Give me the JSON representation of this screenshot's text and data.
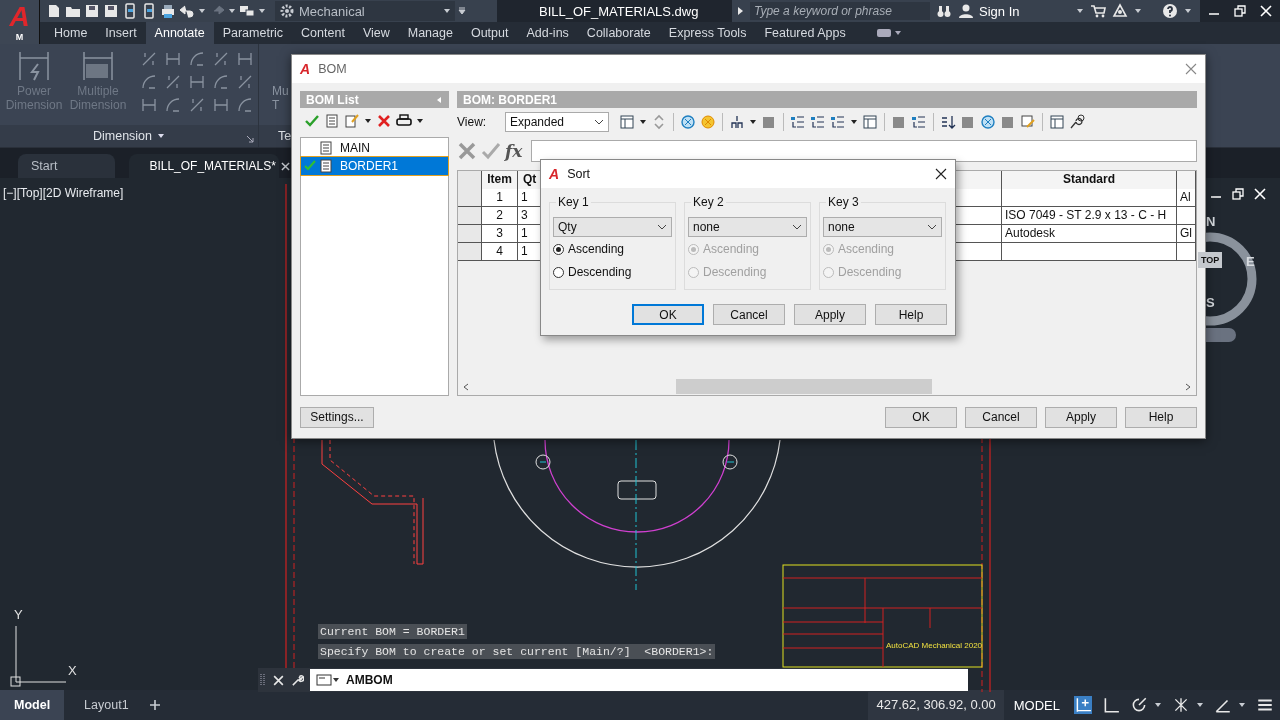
{
  "app_button": {
    "logo": "A",
    "label": "M"
  },
  "title_bar": {
    "workspace": "Mechanical",
    "file_title": "BILL_OF_MATERIALS.dwg",
    "search": {
      "placeholder": "Type a keyword or phrase"
    },
    "sign_in": "Sign In"
  },
  "ribbon": {
    "tabs": [
      {
        "label": "Home",
        "selected": false
      },
      {
        "label": "Insert",
        "selected": false
      },
      {
        "label": "Annotate",
        "selected": true
      },
      {
        "label": "Parametric",
        "selected": false
      },
      {
        "label": "Content",
        "selected": false
      },
      {
        "label": "View",
        "selected": false
      },
      {
        "label": "Manage",
        "selected": false
      },
      {
        "label": "Output",
        "selected": false
      },
      {
        "label": "Add-ins",
        "selected": false
      },
      {
        "label": "Collaborate",
        "selected": false
      },
      {
        "label": "Express Tools",
        "selected": false
      },
      {
        "label": "Featured Apps",
        "selected": false
      }
    ],
    "dimension_panel": {
      "buttons": [
        {
          "lines": [
            "Power",
            "Dimension"
          ]
        },
        {
          "lines": [
            "Multiple",
            "Dimension"
          ]
        }
      ],
      "title": "Dimension"
    },
    "text_panel": {
      "button_lines": [
        "Mu",
        "T"
      ],
      "title": "Te"
    }
  },
  "doc_tabs": [
    {
      "label": "Start",
      "selected": false
    },
    {
      "label": "BILL_OF_MATERIALS*",
      "selected": true
    }
  ],
  "viewport": {
    "label": "[−][Top][2D Wireframe]",
    "viewcube": {
      "north": "N",
      "east": "E",
      "south": "S",
      "face": "TOP"
    },
    "title_block": "AutoCAD Mechanical 2020",
    "ucs": {
      "y": "Y",
      "x": "X"
    }
  },
  "command": {
    "history": [
      "Current BOM = BORDER1",
      "Specify BOM to create or set current [Main/?]  <BORDER1>:"
    ],
    "input": "AMBOM"
  },
  "layout_tabs": [
    {
      "label": "Model",
      "selected": true
    },
    {
      "label": "Layout1",
      "selected": false
    }
  ],
  "status_bar": {
    "coordinates": "427.62, 306.92, 0.00",
    "space": "MODEL"
  },
  "bom_dialog": {
    "icon": "A",
    "title": "BOM",
    "list_header": "BOM List",
    "list": [
      {
        "label": "MAIN",
        "selected": false,
        "current": false
      },
      {
        "label": "BORDER1",
        "selected": true,
        "current": true
      }
    ],
    "main_header": "BOM: BORDER1",
    "view_label": "View:",
    "view_value": "Expanded",
    "formula_symbol": "fx",
    "table": {
      "columns": {
        "item": "Item",
        "qty": "Qt",
        "standard": "Standard"
      },
      "rows": [
        {
          "item": "1",
          "qty": "1",
          "column_6": "Al"
        },
        {
          "item": "2",
          "qty": "3",
          "standard": "ISO 7049 - ST 2.9 x 13 - C - H"
        },
        {
          "item": "3",
          "qty": "1",
          "standard": "Autodesk",
          "column_6": "Gl"
        },
        {
          "item": "4",
          "qty": "1"
        }
      ]
    },
    "settings_button": "Settings...",
    "buttons": [
      {
        "label": "OK",
        "default": false
      },
      {
        "label": "Cancel",
        "default": false
      },
      {
        "label": "Apply",
        "default": false
      },
      {
        "label": "Help",
        "default": false
      }
    ]
  },
  "sort_dialog": {
    "icon": "A",
    "title": "Sort",
    "keys": [
      {
        "label": "Key 1",
        "field": "Qty",
        "disabled": false,
        "options": [
          {
            "label": "Ascending",
            "selected": true
          },
          {
            "label": "Descending",
            "selected": false
          }
        ]
      },
      {
        "label": "Key 2",
        "field": "none",
        "disabled": true,
        "options": [
          {
            "label": "Ascending",
            "selected": true
          },
          {
            "label": "Descending",
            "selected": false
          }
        ]
      },
      {
        "label": "Key 3",
        "field": "none",
        "disabled": true,
        "options": [
          {
            "label": "Ascending",
            "selected": true
          },
          {
            "label": "Descending",
            "selected": false
          }
        ]
      }
    ],
    "buttons": [
      {
        "label": "OK",
        "default": true
      },
      {
        "label": "Cancel",
        "default": false
      },
      {
        "label": "Apply",
        "default": false
      },
      {
        "label": "Help",
        "default": false
      }
    ]
  }
}
